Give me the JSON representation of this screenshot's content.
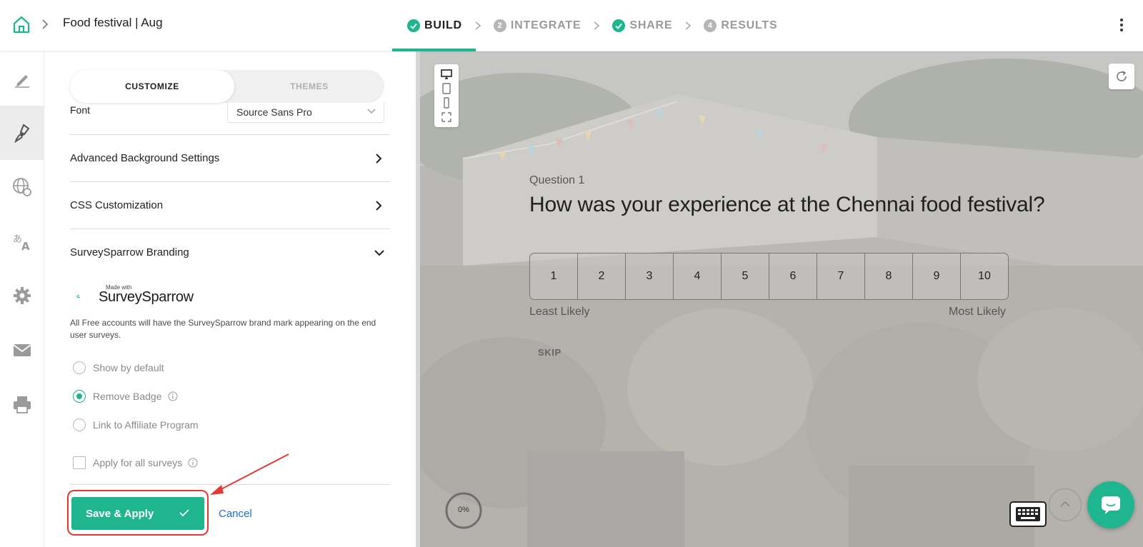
{
  "header": {
    "survey_title": "Food festival | Aug",
    "steps": [
      {
        "label": "BUILD",
        "badge": "",
        "state": "done-active"
      },
      {
        "label": "INTEGRATE",
        "badge": "2",
        "state": "pending"
      },
      {
        "label": "SHARE",
        "badge": "",
        "state": "done"
      },
      {
        "label": "RESULTS",
        "badge": "4",
        "state": "pending"
      }
    ]
  },
  "rail": {
    "items": [
      {
        "icon": "pencil-icon",
        "active": false
      },
      {
        "icon": "paint-brush-icon",
        "active": true
      },
      {
        "icon": "globe-icon",
        "active": false
      },
      {
        "icon": "translate-icon",
        "active": false
      },
      {
        "icon": "gear-icon",
        "active": false
      },
      {
        "icon": "mail-icon",
        "active": false
      },
      {
        "icon": "printer-icon",
        "active": false
      }
    ]
  },
  "panel": {
    "tabs": {
      "customize": "CUSTOMIZE",
      "themes": "THEMES"
    },
    "font_label": "Font",
    "font_value": "Source Sans Pro",
    "sections": {
      "advanced_bg": "Advanced Background Settings",
      "css": "CSS Customization",
      "branding": "SurveySparrow Branding"
    },
    "brand": {
      "made_with": "Made with",
      "name": "SurveySparrow",
      "note": "All Free accounts will have the SurveySparrow brand mark appearing on the end user surveys."
    },
    "options": {
      "show_default": "Show by default",
      "remove_badge": "Remove Badge",
      "affiliate": "Link to Affiliate Program",
      "selected": "Remove Badge"
    },
    "apply_all": "Apply for all surveys",
    "save_label": "Save & Apply",
    "cancel_label": "Cancel"
  },
  "preview": {
    "question_label": "Question 1",
    "question_text": "How was your experience at the Chennai food festival?",
    "scale": [
      "1",
      "2",
      "3",
      "4",
      "5",
      "6",
      "7",
      "8",
      "9",
      "10"
    ],
    "low_label": "Least Likely",
    "high_label": "Most Likely",
    "skip_label": "SKIP",
    "progress": "0%"
  },
  "colors": {
    "accent": "#1fb58f",
    "highlight": "#e53935",
    "link": "#1a6fd6"
  }
}
